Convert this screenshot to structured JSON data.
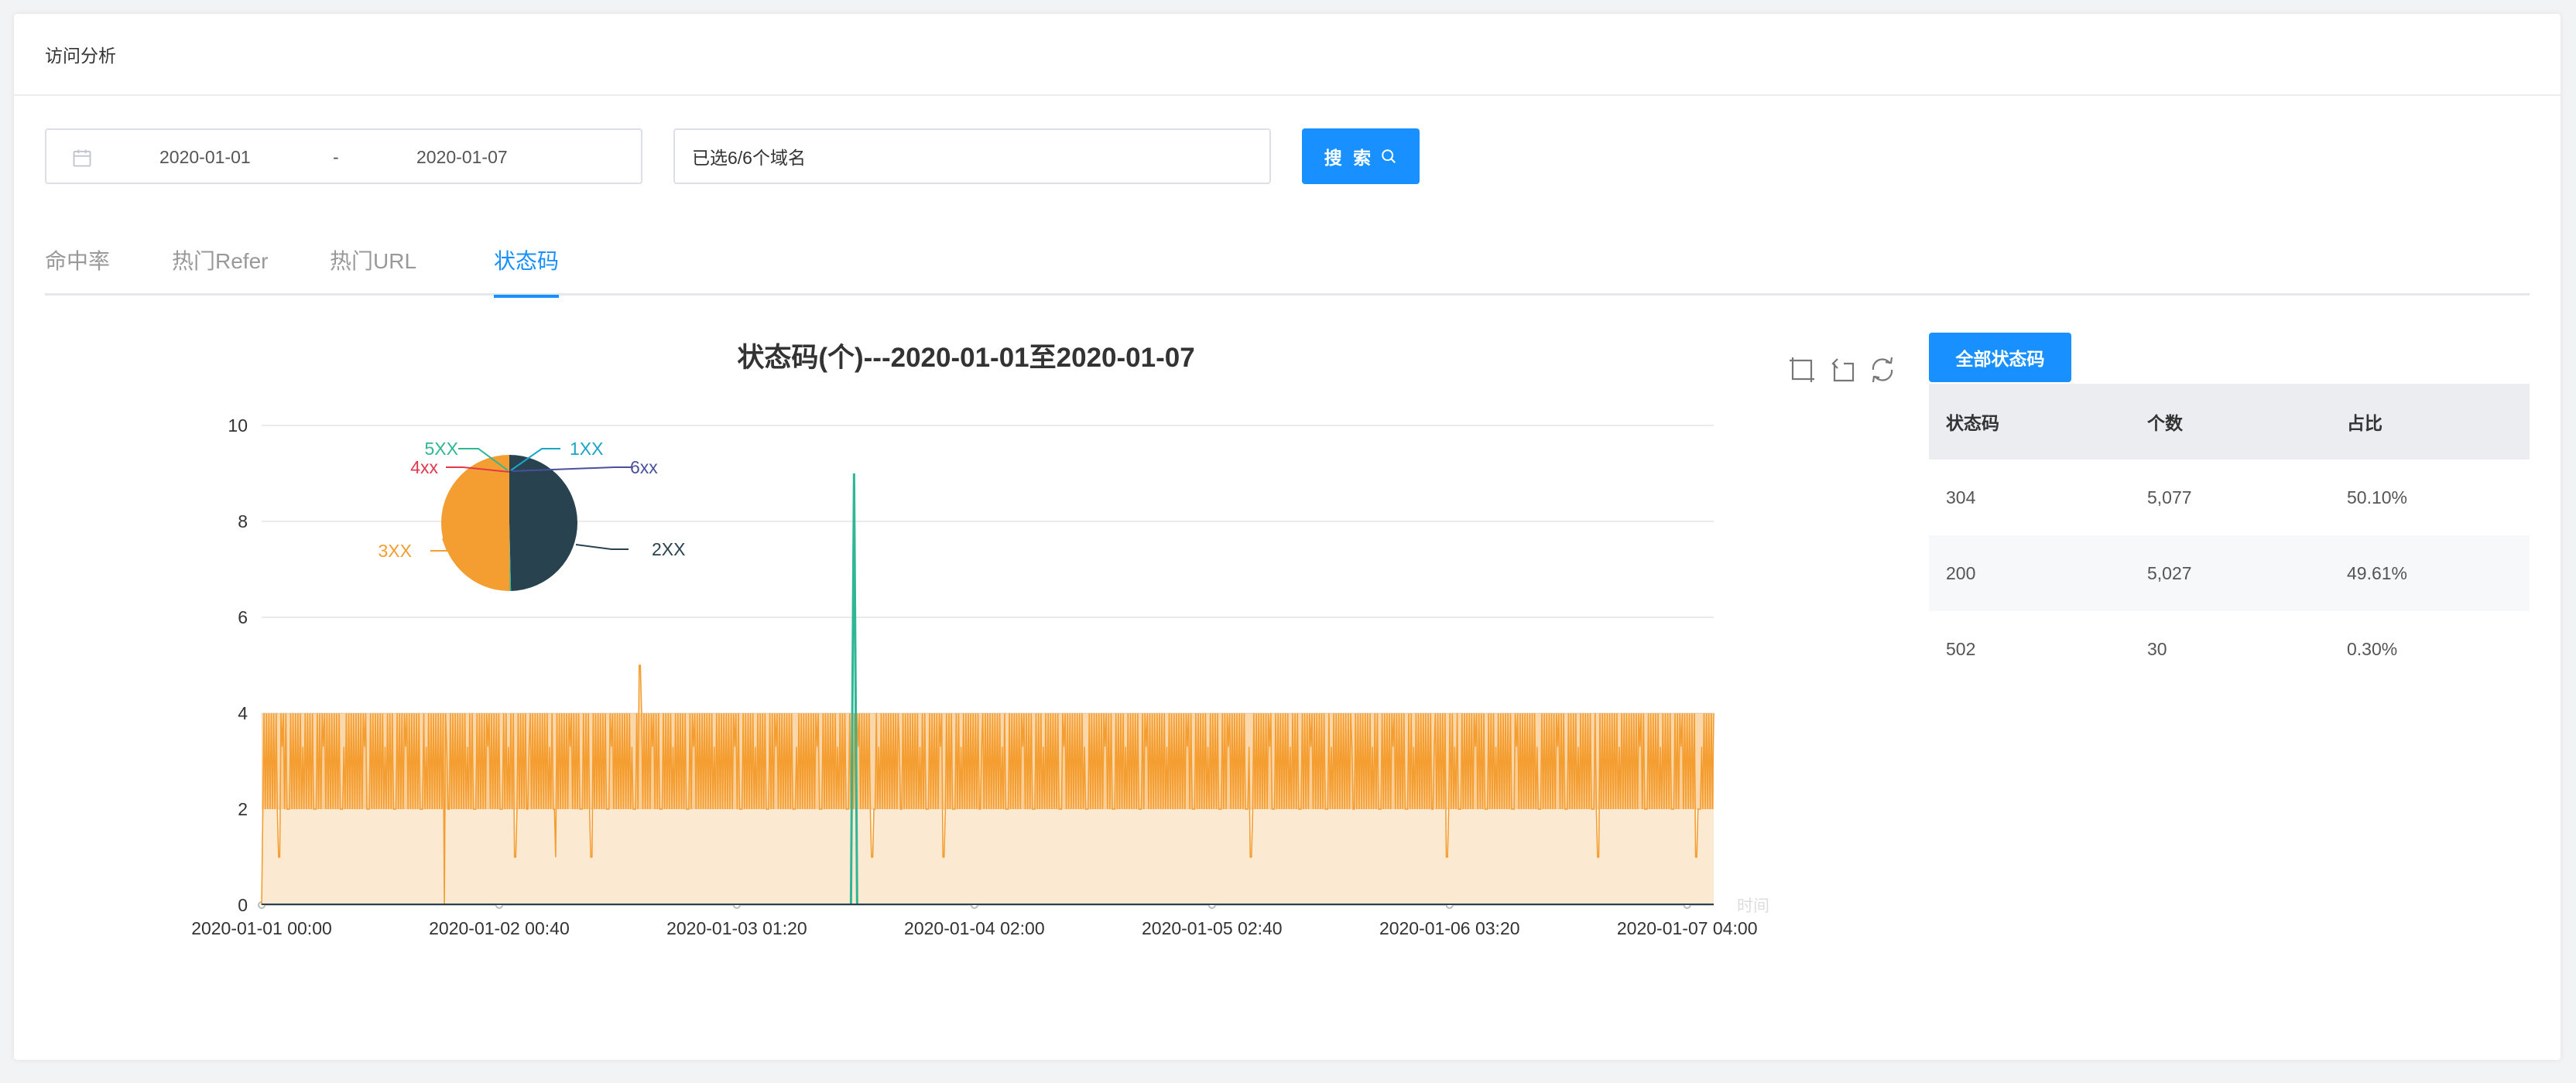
{
  "page": {
    "title": "访问分析"
  },
  "filters": {
    "start_date": "2020-01-01",
    "separator": "-",
    "end_date": "2020-01-07",
    "domain_value": "已选6/6个域名",
    "search_label": "搜 索"
  },
  "tabs": [
    {
      "label": "命中率",
      "active": false
    },
    {
      "label": "热门Refer",
      "active": false
    },
    {
      "label": "热门URL",
      "active": false
    },
    {
      "label": "状态码",
      "active": true
    }
  ],
  "chart_data": [
    {
      "type": "area",
      "title": "状态码(个)---2020-01-01至2020-01-07",
      "xlabel": "时间",
      "ylabel": "",
      "ylim": [
        0,
        10
      ],
      "yticks": [
        0,
        2,
        4,
        6,
        8,
        10
      ],
      "grid": true,
      "x_tick_labels": [
        "2020-01-01 00:00",
        "2020-01-02 00:40",
        "2020-01-03 01:20",
        "2020-01-04 02:00",
        "2020-01-05 02:40",
        "2020-01-06 03:20",
        "2020-01-07 04:00"
      ],
      "x_range_hours": [
        0,
        163
      ],
      "series": [
        {
          "name": "3XX",
          "color": "#f49e32",
          "pattern": "oscillates mostly between 2 and 4 across the whole range",
          "base_low": 2,
          "base_high": 4,
          "dips_to_zero_hours": [
            0,
            20.5,
            42.5
          ],
          "dips_to_1_hours": [
            2,
            28.5,
            33,
            37,
            68.5,
            76.5,
            111,
            133,
            150,
            161
          ],
          "peaks": [
            {
              "hour": 42.5,
              "value": 5
            }
          ]
        },
        {
          "name": "5XX",
          "color": "#2fb695",
          "peaks": [
            {
              "hour": 66.5,
              "value": 9
            }
          ]
        },
        {
          "name": "2XX",
          "color": "#28434f",
          "note": "flat near 0"
        }
      ]
    },
    {
      "type": "pie",
      "slices": [
        {
          "label": "2XX",
          "value": 49.61,
          "color": "#28434f"
        },
        {
          "label": "3XX",
          "value": 50.1,
          "color": "#f49e32"
        },
        {
          "label": "4xx",
          "value": 0.0,
          "color": "#e0384f"
        },
        {
          "label": "5XX",
          "value": 0.3,
          "color": "#2fb695"
        },
        {
          "label": "1XX",
          "value": 0.0,
          "color": "#1aa5c9"
        },
        {
          "label": "6xx",
          "value": 0.0,
          "color": "#4a4f9c"
        }
      ]
    }
  ],
  "table": {
    "button_label": "全部状态码",
    "headers": [
      "状态码",
      "个数",
      "占比"
    ],
    "rows": [
      [
        "304",
        "5,077",
        "50.10%"
      ],
      [
        "200",
        "5,027",
        "49.61%"
      ],
      [
        "502",
        "30",
        "0.30%"
      ]
    ]
  },
  "toolbox": {
    "icons": [
      "zoom-icon",
      "zoom-reset-icon",
      "restore-icon"
    ]
  }
}
